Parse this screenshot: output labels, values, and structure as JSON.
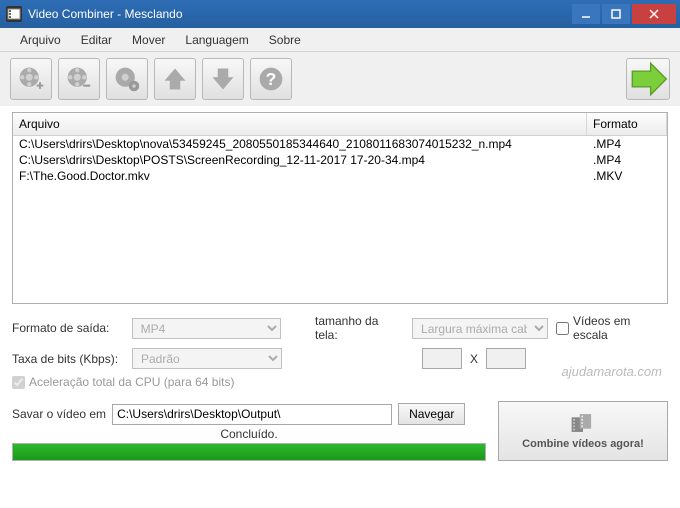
{
  "window": {
    "title": "Video Combiner - Mesclando"
  },
  "menu": {
    "items": [
      "Arquivo",
      "Editar",
      "Mover",
      "Languagem",
      "Sobre"
    ]
  },
  "filelist": {
    "headers": {
      "file": "Arquivo",
      "format": "Formato"
    },
    "rows": [
      {
        "path": "C:\\Users\\drirs\\Desktop\\nova\\53459245_2080550185344640_2108011683074015232_n.mp4",
        "format": ".MP4"
      },
      {
        "path": "C:\\Users\\drirs\\Desktop\\POSTS\\ScreenRecording_12-11-2017 17-20-34.mp4",
        "format": ".MP4"
      },
      {
        "path": "F:\\The.Good.Doctor.mkv",
        "format": ".MKV"
      }
    ]
  },
  "form": {
    "output_format_label": "Formato de saída:",
    "output_format_value": "MP4",
    "screen_size_label": "tamanho da tela:",
    "screen_size_value": "Largura máxima cabida",
    "scale_videos_label": "Vídeos em escala",
    "bitrate_label": "Taxa de bits (Kbps):",
    "bitrate_value": "Padrão",
    "dim_x": "X",
    "cpu_accel_label": "Aceleração total da CPU (para 64 bits)",
    "save_label": "Savar o vídeo em",
    "save_path": "C:\\Users\\drirs\\Desktop\\Output\\",
    "browse_label": "Navegar",
    "status": "Concluído.",
    "combine_label": "Combine vídeos agora!"
  },
  "watermark": "ajudamarota.com"
}
